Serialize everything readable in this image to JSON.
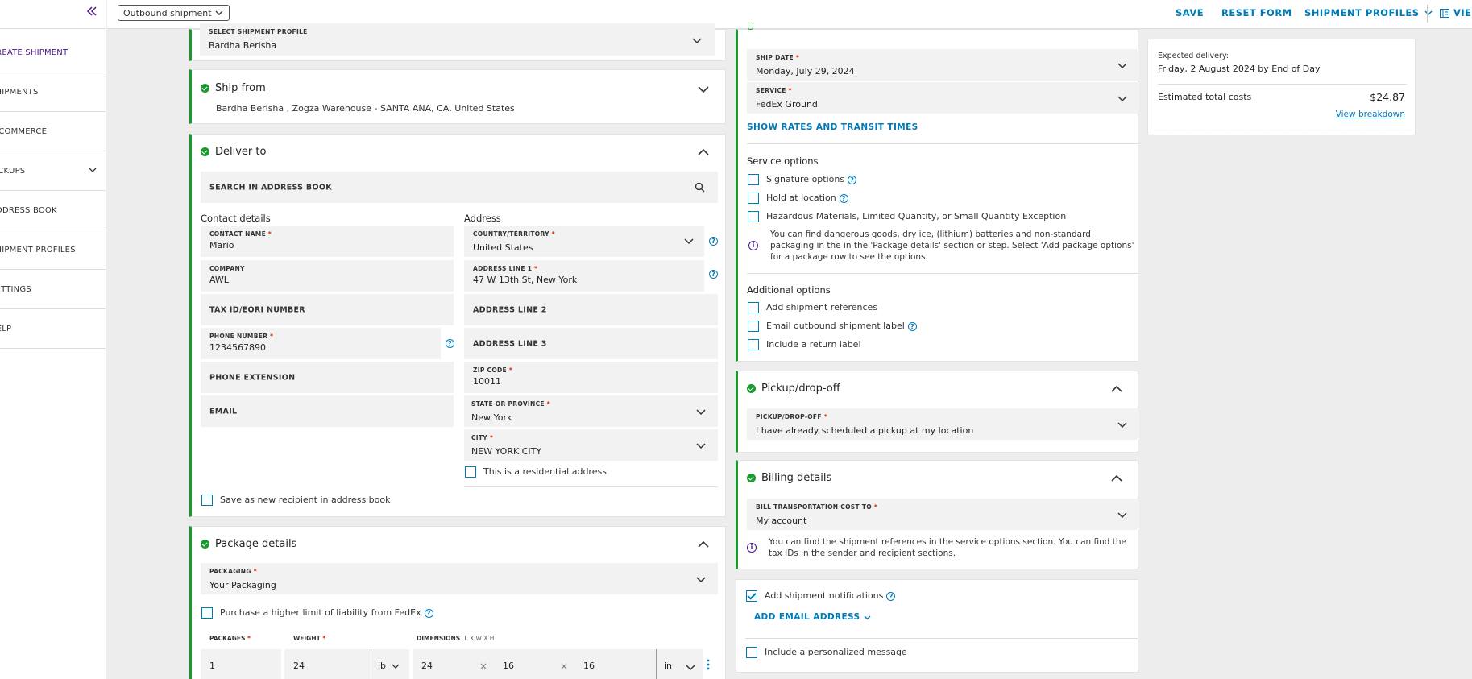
{
  "sidebar": {
    "items": [
      {
        "label": "CREATE SHIPMENT",
        "active": true
      },
      {
        "label": "SHIPMENTS"
      },
      {
        "label": "E-COMMERCE"
      },
      {
        "label": "PICKUPS",
        "has_chevron": true
      },
      {
        "label": "ADDRESS BOOK"
      },
      {
        "label": "SHIPMENT PROFILES"
      },
      {
        "label": "SETTINGS"
      },
      {
        "label": "HELP"
      }
    ]
  },
  "topbar": {
    "shipment_type": "Outbound shipment",
    "save": "SAVE",
    "reset": "RESET FORM",
    "profiles": "SHIPMENT PROFILES",
    "view": "VIE"
  },
  "profile": {
    "label": "SELECT SHIPMENT PROFILE",
    "value": "Bardha Berisha"
  },
  "ship_from": {
    "title": "Ship from",
    "summary": "Bardha Berisha , Zogza Warehouse - SANTA ANA, CA, United States"
  },
  "deliver_to": {
    "title": "Deliver to",
    "search_placeholder": "SEARCH IN ADDRESS BOOK",
    "contact_heading": "Contact details",
    "address_heading": "Address",
    "contact_name": {
      "label": "CONTACT NAME",
      "value": "Mario"
    },
    "company": {
      "label": "COMPANY",
      "value": "AWL"
    },
    "tax_id": "TAX ID/EORI NUMBER",
    "phone": {
      "label": "PHONE NUMBER",
      "value": "1234567890"
    },
    "phone_ext": "PHONE EXTENSION",
    "email": "EMAIL",
    "country": {
      "label": "COUNTRY/TERRITORY",
      "value": "United States"
    },
    "address1": {
      "label": "ADDRESS LINE 1",
      "value": "47 W 13th St, New York"
    },
    "address2": "ADDRESS LINE 2",
    "address3": "ADDRESS LINE 3",
    "zip": {
      "label": "ZIP CODE",
      "value": "10011"
    },
    "state": {
      "label": "STATE OR PROVINCE",
      "value": "New York"
    },
    "city": {
      "label": "CITY",
      "value": "NEW YORK CITY"
    },
    "residential": "This is a residential address",
    "save_recipient": "Save as new recipient in address book"
  },
  "package": {
    "title": "Package details",
    "packaging": {
      "label": "PACKAGING",
      "value": "Your Packaging"
    },
    "liability": "Purchase a higher limit of liability from FedEx",
    "packages_label": "PACKAGES",
    "weight_label": "WEIGHT",
    "dimensions_label": "DIMENSIONS",
    "dimensions_hint": "L X W X H",
    "packages_value": "1",
    "weight_value": "24",
    "weight_unit": "lb",
    "dim_l": "24",
    "dim_w": "16",
    "dim_h": "16",
    "dim_unit": "in",
    "times": "×"
  },
  "service": {
    "ship_date": {
      "label": "SHIP DATE",
      "value": "Monday, July 29, 2024"
    },
    "service": {
      "label": "SERVICE",
      "value": "FedEx Ground"
    },
    "rates_link": "SHOW RATES AND TRANSIT TIMES",
    "service_options_heading": "Service options",
    "signature": "Signature options",
    "hold": "Hold at location",
    "hazmat": "Hazardous Materials, Limited Quantity, or Small Quantity Exception",
    "info_text": "You can find dangerous goods, dry ice, (lithium) batteries and non-standard packaging in the in the 'Package details' section or step. Select 'Add package options' for a package row to see the options.",
    "additional_heading": "Additional options",
    "add_references": "Add shipment references",
    "email_label": "Email outbound shipment label",
    "return_label": "Include a return label"
  },
  "pickup": {
    "title": "Pickup/drop-off",
    "field": {
      "label": "PICKUP/DROP-OFF",
      "value": "I have already scheduled a pickup at my location"
    }
  },
  "billing": {
    "title": "Billing details",
    "field": {
      "label": "BILL TRANSPORTATION COST TO",
      "value": "My account"
    },
    "info_text": "You can find the shipment references in the service options section. You can find the tax IDs in the sender and recipient sections."
  },
  "notifications": {
    "add_notifications": "Add shipment notifications",
    "add_email": "ADD EMAIL ADDRESS",
    "personal_message": "Include a personalized message"
  },
  "summary": {
    "expected_label": "Expected delivery:",
    "expected_value": "Friday, 2 August 2024 by End of Day",
    "total_label": "Estimated total costs",
    "total_value": "$24.87",
    "breakdown_link": "View breakdown"
  },
  "colors": {
    "accent": "#007ab7",
    "brand": "#4d148c",
    "success": "#1a9a2e"
  }
}
